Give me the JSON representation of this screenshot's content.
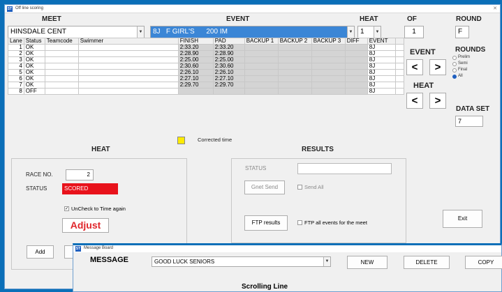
{
  "window_title": "Off line scoring",
  "headers": {
    "meet": "MEET",
    "event": "EVENT",
    "heat": "HEAT",
    "of": "OF",
    "round": "ROUND"
  },
  "meet_value": "HINSDALE CENT",
  "event_value": "8J   F GIRL'S      200 IM",
  "heat_value": "1",
  "of_value": "1",
  "round_value": "F",
  "grid": {
    "columns": [
      "Lane",
      "Status",
      "Teamcode",
      "Swimmer",
      "FINISH",
      "PAD",
      "BACKUP 1",
      "BACKUP 2",
      "BACKUP 3",
      "DIFF",
      "EVENT"
    ],
    "rows": [
      {
        "lane": "1",
        "status": "OK",
        "finish": "2:33.20",
        "pad": "2:33.20",
        "event": "8J"
      },
      {
        "lane": "2",
        "status": "OK",
        "finish": "2:28.90",
        "pad": "2:28.90",
        "event": "8J"
      },
      {
        "lane": "3",
        "status": "OK",
        "finish": "2:25.00",
        "pad": "2:25.00",
        "event": "8J"
      },
      {
        "lane": "4",
        "status": "OK",
        "finish": "2:30.60",
        "pad": "2:30.60",
        "event": "8J"
      },
      {
        "lane": "5",
        "status": "OK",
        "finish": "2:26.10",
        "pad": "2:26.10",
        "event": "8J"
      },
      {
        "lane": "6",
        "status": "OK",
        "finish": "2:27.10",
        "pad": "2:27.10",
        "event": "8J"
      },
      {
        "lane": "7",
        "status": "OK",
        "finish": "2:29.70",
        "pad": "2:29.70",
        "event": "8J"
      },
      {
        "lane": "8",
        "status": "OFF",
        "finish": "",
        "pad": "",
        "event": "8J"
      }
    ]
  },
  "nav": {
    "event_label": "EVENT",
    "heat_label": "HEAT",
    "prev": "<",
    "next": ">"
  },
  "rounds": {
    "label": "ROUNDS",
    "options": [
      "Prelim",
      "Semi",
      "Final",
      "All"
    ],
    "selected": "All"
  },
  "data_set": {
    "label": "DATA SET",
    "value": "7"
  },
  "legend": {
    "corrected": "Corrected time",
    "color": "#ffeb00"
  },
  "heat_panel": {
    "title": "HEAT",
    "race_no_label": "RACE NO.",
    "race_no_value": "2",
    "status_label": "STATUS",
    "status_value": "SCORED",
    "status_color": "#e8121b",
    "uncheck_label": "UnCheck to Time again",
    "adjust_label": "Adjust",
    "add_label": "Add"
  },
  "results_panel": {
    "title": "RESULTS",
    "status_label": "STATUS",
    "gnet_send": "Gnet Send",
    "send_all": "Send All",
    "ftp_results": "FTP results",
    "ftp_all": "FTP all events for the meet",
    "exit": "Exit"
  },
  "message_board": {
    "title": "Message Board",
    "label": "MESSAGE",
    "value": "GOOD LUCK SENIORS",
    "new": "NEW",
    "delete": "DELETE",
    "copy": "COPY",
    "scrolling": "Scrolling Line"
  }
}
